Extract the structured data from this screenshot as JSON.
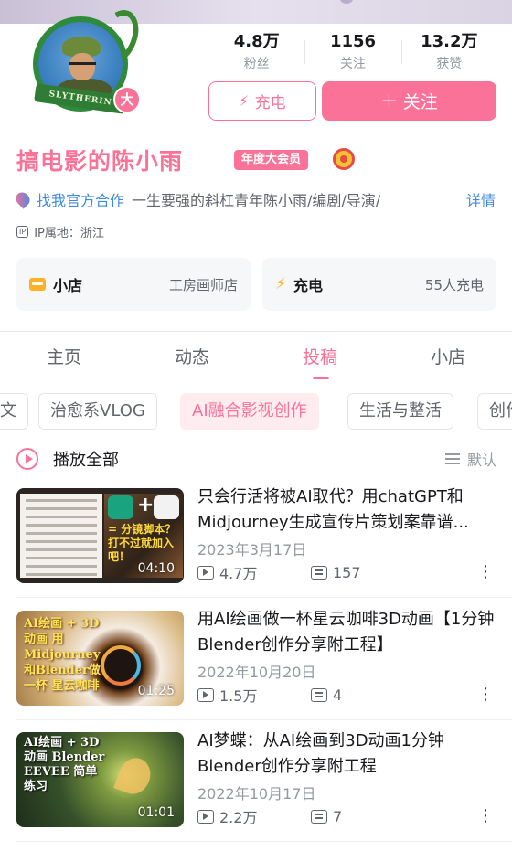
{
  "profile": {
    "avatar_ribbon": "SLYTHERIN",
    "vip_badge": "大",
    "username": "搞电影的陈小雨",
    "annual_badge": "年度大会员",
    "official_link": "找我官方合作",
    "bio": "一生要强的斜杠青年陈小雨/编剧/导演/",
    "detail_label": "详情",
    "ip_tag": "IP",
    "ip_location": "IP属地：浙江"
  },
  "stats": [
    {
      "value": "4.8万",
      "label": "粉丝"
    },
    {
      "value": "1156",
      "label": "关注"
    },
    {
      "value": "13.2万",
      "label": "获赞"
    }
  ],
  "actions": {
    "charge_label": "充电",
    "follow_label": "关注"
  },
  "cards": {
    "shop": {
      "title": "小店",
      "subtitle": "工房画师店"
    },
    "charge": {
      "title": "充电",
      "subtitle": "55人充电"
    }
  },
  "tabs": [
    {
      "label": "主页",
      "active": false
    },
    {
      "label": "动态",
      "active": false
    },
    {
      "label": "投稿",
      "active": true
    },
    {
      "label": "小店",
      "active": false
    }
  ],
  "chips": [
    {
      "label": "文",
      "active": false
    },
    {
      "label": "治愈系VLOG",
      "active": false
    },
    {
      "label": "AI融合影视创作",
      "active": true
    },
    {
      "label": "生活与整活",
      "active": false
    },
    {
      "label": "创作",
      "active": false
    }
  ],
  "playall": {
    "label": "播放全部",
    "sort_label": "默认"
  },
  "videos": [
    {
      "title": "只会行活将被AI取代？用chatGPT和Midjourney生成宣传片策划案靠谱...",
      "date": "2023年3月17日",
      "views": "4.7万",
      "danmaku": "157",
      "duration": "04:10",
      "thumb_text": "= 分镜脚本？打不过就加入吧！"
    },
    {
      "title": "用AI绘画做一杯星云咖啡3D动画【1分钟Blender创作分享附工程】",
      "date": "2022年10月20日",
      "views": "1.5万",
      "danmaku": "4",
      "duration": "01:25",
      "thumb_text": "AI绘画 + 3D动画 用Midjourney和Blender做一杯 星云咖啡"
    },
    {
      "title": "AI梦蝶：从AI绘画到3D动画1分钟Blender创作分享附工程",
      "date": "2022年10月17日",
      "views": "2.2万",
      "danmaku": "7",
      "duration": "01:01",
      "thumb_text": "AI绘画 + 3D动画 Blender EEVEE 简单练习"
    }
  ],
  "colors": {
    "accent_pink": "#fb7299",
    "link_blue": "#3f8be0",
    "gold": "#ffb027"
  }
}
